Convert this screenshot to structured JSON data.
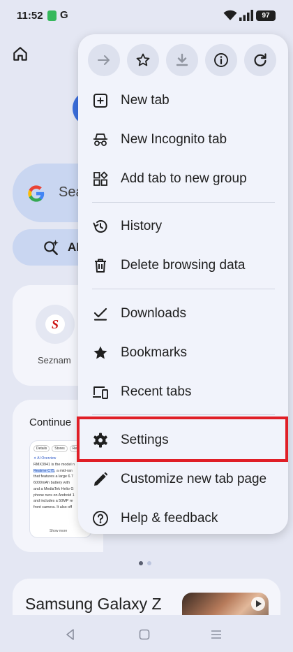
{
  "status_bar": {
    "time": "11:52",
    "app_letter": "G",
    "battery": "97"
  },
  "background": {
    "search_text": "Sea",
    "ai_text": "AI",
    "shortcut_letter": "S",
    "shortcut_label": "Seznam",
    "continue_label": "Continue",
    "thumbnail": {
      "tabs": [
        "Details",
        "Stores",
        "Rea"
      ],
      "ai_label": "✦ AI Overview",
      "lines": [
        "RMX3941 is the model n",
        "Realme C75, a mid-ran",
        "that features a large 6.7",
        "6000mAh battery with",
        "and a MediaTek Helio G",
        "phone runs on Android 1",
        "and includes a 50MP re",
        "front camera. It also off"
      ],
      "highlight": "Realme C75",
      "more": "Show more"
    },
    "news_title": "Samsung Galaxy Z Fold"
  },
  "menu": {
    "toolbar": [
      {
        "name": "forward-icon"
      },
      {
        "name": "star-icon"
      },
      {
        "name": "download-icon"
      },
      {
        "name": "info-icon"
      },
      {
        "name": "refresh-icon"
      }
    ],
    "items": [
      {
        "label": "New tab",
        "icon": "new-tab-icon"
      },
      {
        "label": "New Incognito tab",
        "icon": "incognito-icon"
      },
      {
        "label": "Add tab to new group",
        "icon": "tab-group-icon"
      },
      {
        "label": "History",
        "icon": "history-icon"
      },
      {
        "label": "Delete browsing data",
        "icon": "trash-icon"
      },
      {
        "label": "Downloads",
        "icon": "downloads-icon"
      },
      {
        "label": "Bookmarks",
        "icon": "bookmark-star-icon"
      },
      {
        "label": "Recent tabs",
        "icon": "devices-icon"
      },
      {
        "label": "Settings",
        "icon": "gear-icon"
      },
      {
        "label": "Customize new tab page",
        "icon": "pencil-icon"
      },
      {
        "label": "Help & feedback",
        "icon": "help-icon"
      }
    ],
    "highlight_color": "#e01e26"
  }
}
